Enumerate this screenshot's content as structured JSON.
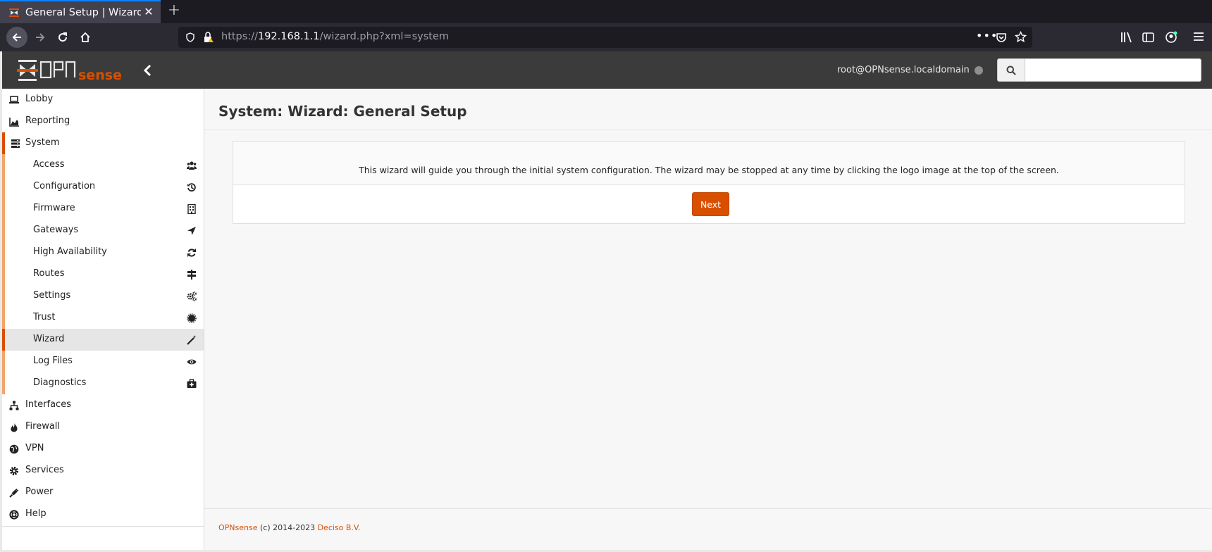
{
  "browser": {
    "tab_title": "General Setup | Wizard |",
    "url_prefix": "https://",
    "url_host": "192.168.1.1",
    "url_path": "/wizard.php?xml=system"
  },
  "header": {
    "user": "root@OPNsense.localdomain",
    "search_placeholder": ""
  },
  "sidebar": {
    "top_items": [
      {
        "label": "Lobby",
        "icon": "laptop-icon"
      },
      {
        "label": "Reporting",
        "icon": "area-chart-icon"
      },
      {
        "label": "System",
        "icon": "server-icon"
      }
    ],
    "system_items": [
      {
        "label": "Access",
        "icon": "users-icon"
      },
      {
        "label": "Configuration",
        "icon": "history-icon"
      },
      {
        "label": "Firmware",
        "icon": "building-icon"
      },
      {
        "label": "Gateways",
        "icon": "location-arrow-icon"
      },
      {
        "label": "High Availability",
        "icon": "refresh-icon"
      },
      {
        "label": "Routes",
        "icon": "map-signs-icon"
      },
      {
        "label": "Settings",
        "icon": "cogs-icon"
      },
      {
        "label": "Trust",
        "icon": "certificate-icon"
      },
      {
        "label": "Wizard",
        "icon": "magic-wand-icon"
      },
      {
        "label": "Log Files",
        "icon": "eye-icon"
      },
      {
        "label": "Diagnostics",
        "icon": "medkit-icon"
      }
    ],
    "bottom_items": [
      {
        "label": "Interfaces",
        "icon": "sitemap-icon"
      },
      {
        "label": "Firewall",
        "icon": "fire-icon"
      },
      {
        "label": "VPN",
        "icon": "globe-icon"
      },
      {
        "label": "Services",
        "icon": "cog-icon"
      },
      {
        "label": "Power",
        "icon": "plug-icon"
      },
      {
        "label": "Help",
        "icon": "life-ring-icon"
      }
    ]
  },
  "main": {
    "title": "System: Wizard: General Setup",
    "wizard_description": "This wizard will guide you through the initial system configuration. The wizard may be stopped at any time by clicking the logo image at the top of the screen.",
    "next_label": "Next"
  },
  "footer": {
    "brand": "OPNsense",
    "copyright": " (c) 2014-2023 ",
    "company": "Deciso B.V."
  },
  "colors": {
    "accent": "#d94f00",
    "header_bg": "#3b3b3b",
    "submenu_border": "#f2a56a"
  }
}
